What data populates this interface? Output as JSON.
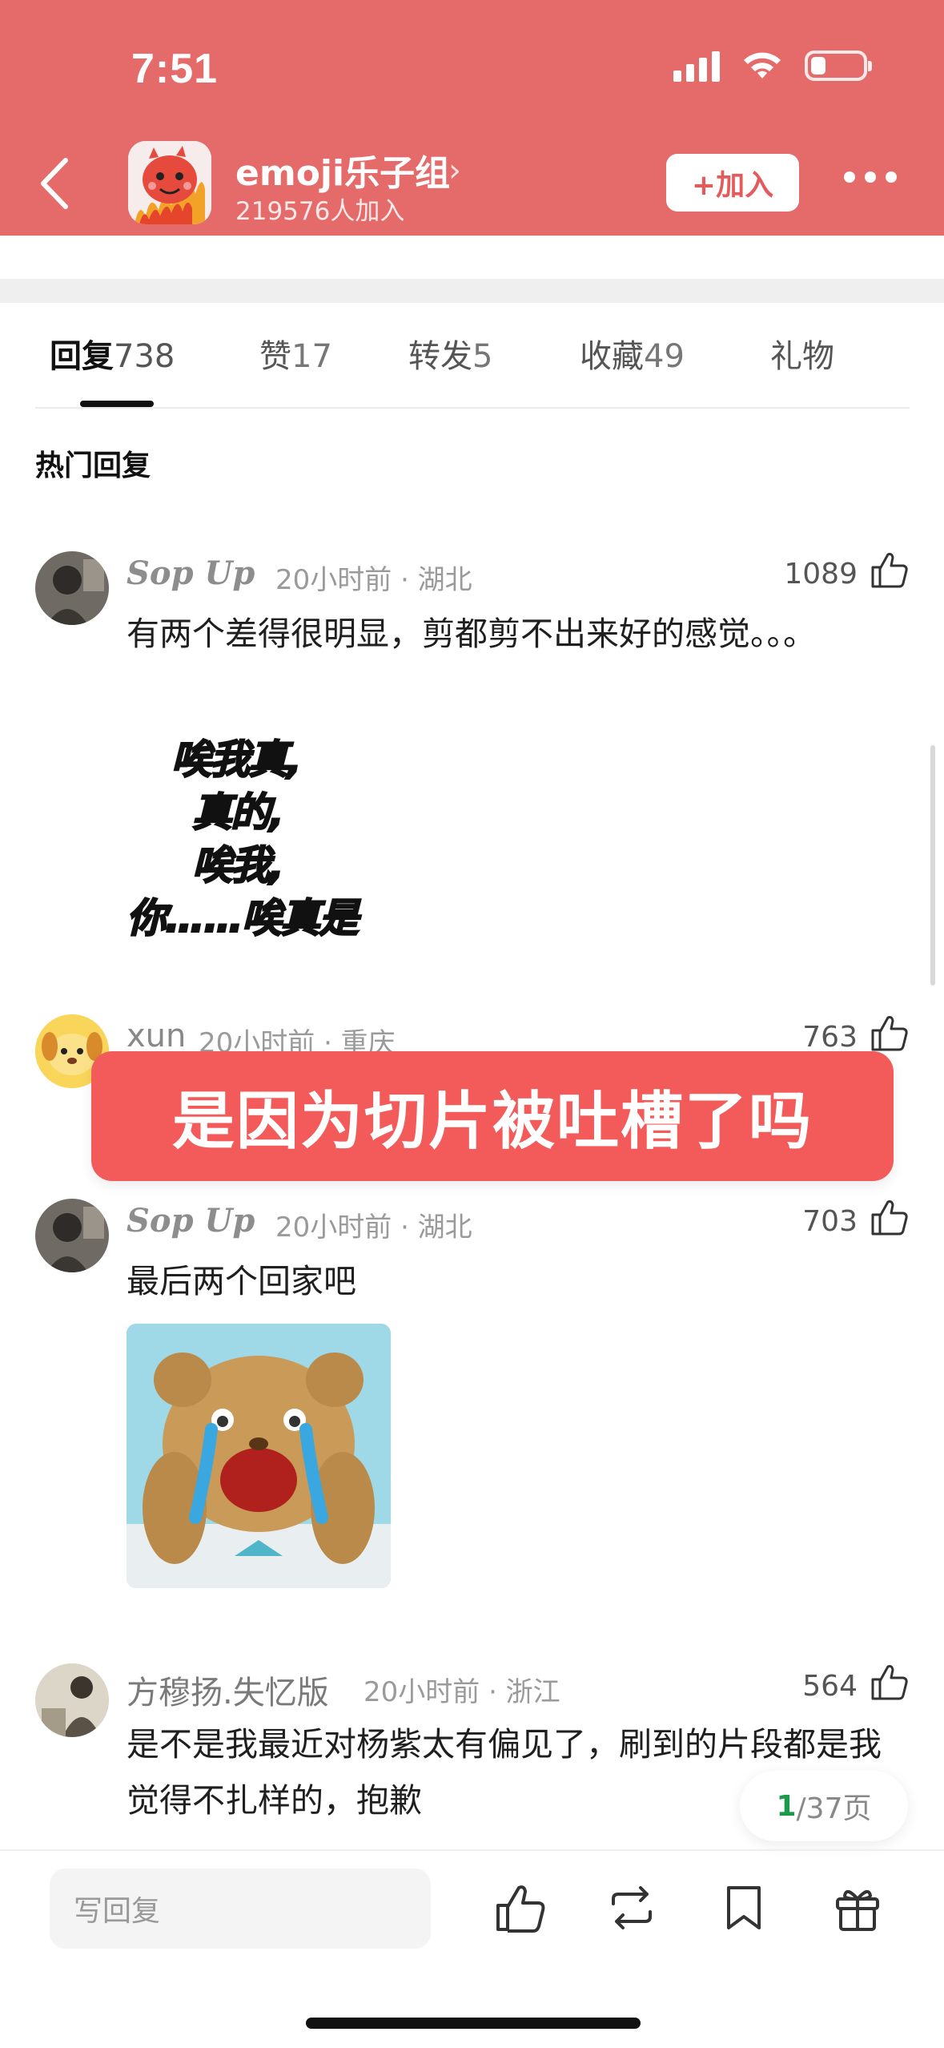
{
  "status_bar": {
    "time": "7:51"
  },
  "header": {
    "group_name": "emoji乐子组",
    "group_chevron": "›",
    "member_text": "219576人加入",
    "join_label": "+加入"
  },
  "tabs": [
    {
      "label": "回复",
      "count": "738"
    },
    {
      "label": "赞",
      "count": "17"
    },
    {
      "label": "转发",
      "count": "5"
    },
    {
      "label": "收藏",
      "count": "49"
    },
    {
      "label": "礼物",
      "count": ""
    }
  ],
  "section_title": "热门回复",
  "comments": [
    {
      "name": "Sop Up",
      "meta": "20小时前 · 湖北",
      "likes": "1089",
      "text": "有两个差得很明显，剪都剪不出来好的感觉。。。",
      "meme_lines": [
        "唉我真,",
        "真的,",
        "唉我,",
        "你……唉真是"
      ]
    },
    {
      "name": "xun",
      "meta": "20小时前 · 重庆",
      "likes": "763"
    },
    {
      "name": "Sop Up",
      "meta": "20小时前 · 湖北",
      "likes": "703",
      "text": "最后两个回家吧"
    },
    {
      "name": "方穆扬.失忆版",
      "meta": "20小时前 · 浙江",
      "likes": "564",
      "text": "是不是我最近对杨紫太有偏见了，刷到的片段都是我觉得不扎样的，抱歉"
    }
  ],
  "banner_text": "是因为切片被吐槽了吗",
  "pagination": {
    "current": "1",
    "total_text": "/37页"
  },
  "bottom_bar": {
    "reply_placeholder": "写回复"
  },
  "icons": [
    "back-icon",
    "more-icon",
    "like-icon",
    "repost-icon",
    "bookmark-icon",
    "gift-icon",
    "signal-icon",
    "wifi-icon",
    "battery-icon"
  ],
  "colors": {
    "header_bg": "#e56a6a",
    "banner_bg": "#f35b5b",
    "page_current": "#1a9a4a"
  }
}
